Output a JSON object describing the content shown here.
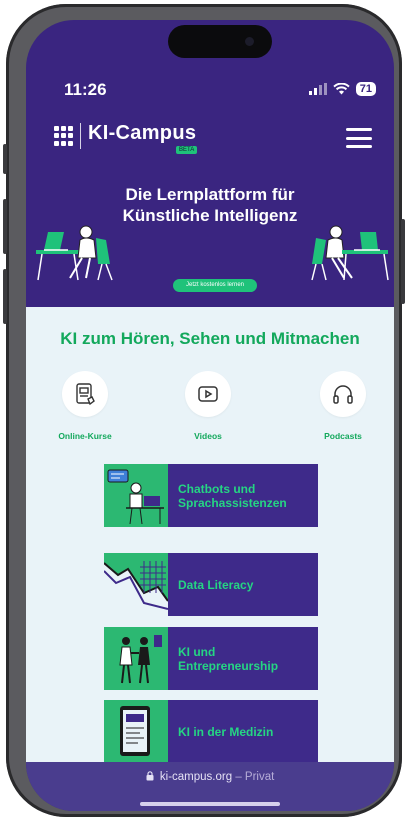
{
  "status": {
    "time": "11:26",
    "battery": "71"
  },
  "header": {
    "brand": "KI-Campus",
    "badge": "BETA"
  },
  "hero": {
    "title": "Die Lernplattform für Künstliche Intelligenz",
    "cta": "Jetzt kostenlos lernen"
  },
  "section": {
    "title": "KI zum Hören, Sehen und Mitmachen"
  },
  "categories": [
    {
      "label": "Online-Kurse",
      "icon": "tablet-course-icon"
    },
    {
      "label": "Videos",
      "icon": "play-icon"
    },
    {
      "label": "Podcasts",
      "icon": "headphones-icon"
    }
  ],
  "cards": [
    {
      "title": "Chatbots und Sprachassistenzen"
    },
    {
      "title": "Data Literacy"
    },
    {
      "title": "KI und Entrepreneurship"
    },
    {
      "title": "KI in der Medizin"
    }
  ],
  "browser": {
    "domain": "ki-campus.org",
    "mode": "– Privat"
  },
  "colors": {
    "brand_purple": "#3a2580",
    "brand_green": "#1fc27a",
    "content_bg": "#e9f3f8"
  }
}
